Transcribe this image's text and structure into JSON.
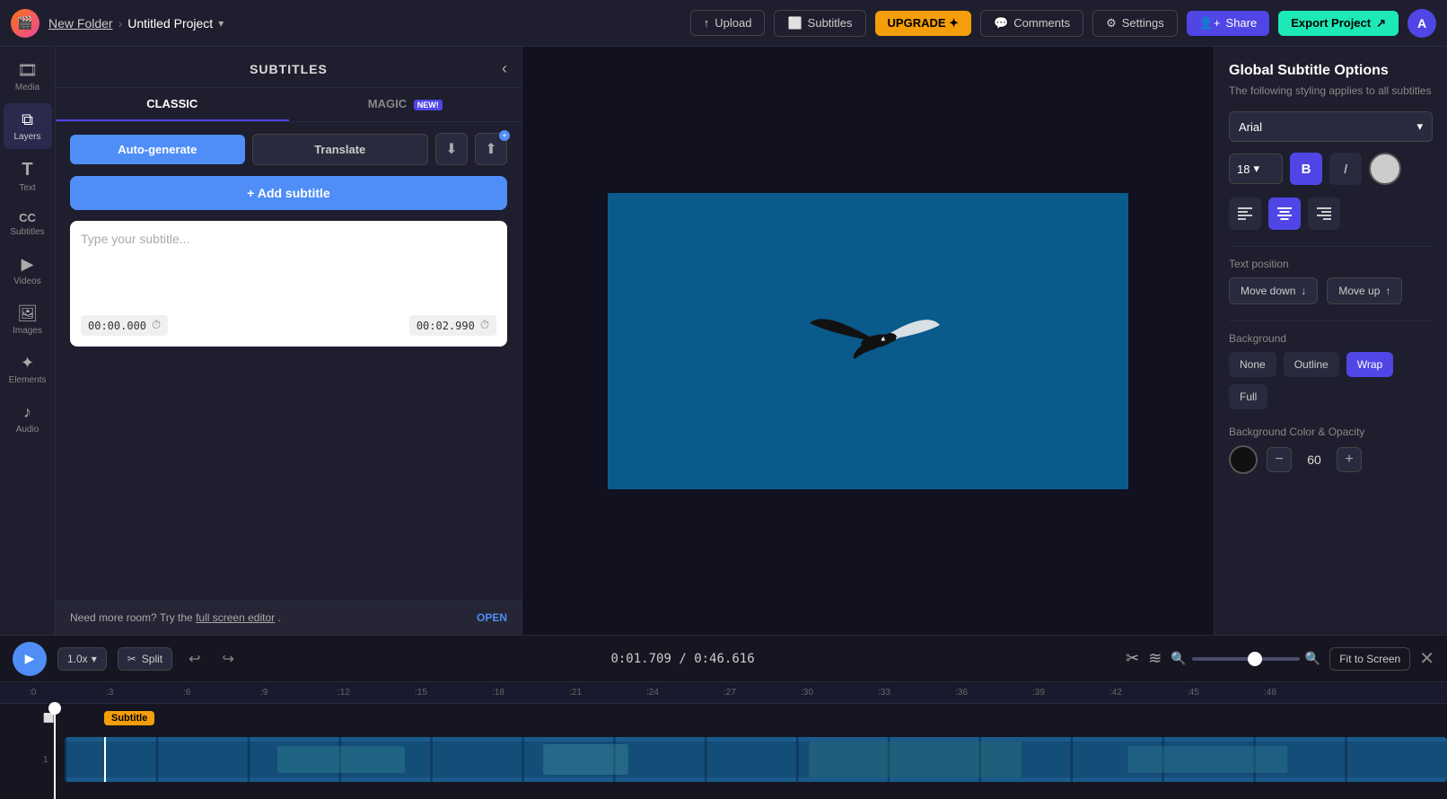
{
  "app": {
    "logo": "🎬",
    "folder": "New Folder",
    "project": "Untitled Project"
  },
  "topnav": {
    "upload": "Upload",
    "subtitles": "Subtitles",
    "upgrade": "UPGRADE ✦",
    "comments": "Comments",
    "settings": "Settings",
    "share": "Share",
    "export": "Export Project",
    "avatar": "A"
  },
  "sidebar": {
    "items": [
      {
        "label": "Media",
        "icon": "🎞"
      },
      {
        "label": "Layers",
        "icon": "⧉"
      },
      {
        "label": "Text",
        "icon": "T"
      },
      {
        "label": "Subtitles",
        "icon": "CC"
      },
      {
        "label": "Videos",
        "icon": "▶"
      },
      {
        "label": "Images",
        "icon": "🖼"
      },
      {
        "label": "Elements",
        "icon": "✦"
      },
      {
        "label": "Audio",
        "icon": "♪"
      }
    ]
  },
  "panel": {
    "title": "SUBTITLES",
    "tab_classic": "CLASSIC",
    "tab_magic": "MAGIC",
    "tab_magic_badge": "NEW!",
    "btn_autogen": "Auto-generate",
    "btn_translate": "Translate",
    "add_subtitle": "+ Add subtitle",
    "subtitle_placeholder": "Type your subtitle...",
    "timecode_start": "00:00.000",
    "timecode_end": "00:02.990",
    "footer_text": "Need more room? Try the",
    "footer_link": "full screen editor",
    "footer_period": ".",
    "btn_open": "OPEN"
  },
  "right_panel": {
    "title": "Global Subtitle Options",
    "subtitle": "The following styling applies to all subtitles",
    "font": "Arial",
    "font_size": "18",
    "btn_bold": "B",
    "btn_italic": "I",
    "text_position": "Text position",
    "move_down": "Move down",
    "move_up": "Move up",
    "background": "Background",
    "bg_none": "None",
    "bg_outline": "Outline",
    "bg_wrap": "Wrap",
    "bg_full": "Full",
    "bg_color_opacity": "Background Color & Opacity",
    "opacity_value": "60"
  },
  "playback": {
    "speed": "1.0x",
    "split": "Split",
    "time_current": "0:01.709",
    "time_total": "0:46.616",
    "fit_screen": "Fit to Screen"
  },
  "timeline": {
    "ticks": [
      ":0",
      ":3",
      ":6",
      ":9",
      ":12",
      ":15",
      ":18",
      ":21",
      ":24",
      ":27",
      ":30",
      ":33",
      ":36",
      ":39",
      ":42",
      ":45",
      ":48"
    ],
    "subtitle_chip": "Subtitle",
    "track_num": "1"
  }
}
